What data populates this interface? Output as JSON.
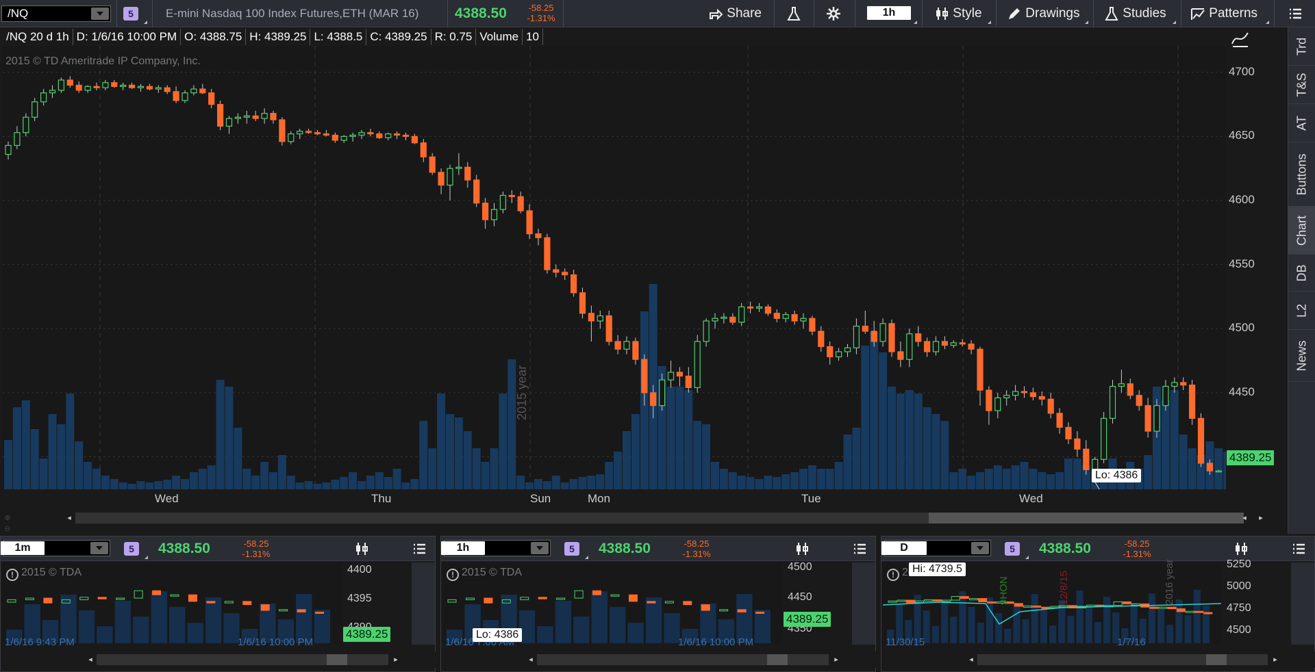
{
  "top": {
    "symbol": "/NQ",
    "group": "5",
    "description": "E-mini Nasdaq 100 Index Futures,ETH (MAR 16)",
    "last": "4388.50",
    "change": "-58.25",
    "change_pct": "-1.31%",
    "timeframe": "1h",
    "share_label": "Share",
    "style_label": "Style",
    "drawings_label": "Drawings",
    "studies_label": "Studies",
    "patterns_label": "Patterns"
  },
  "info": {
    "title": "/NQ 20 d 1h",
    "date": "D: 1/6/16 10:00 PM",
    "open": "O: 4388.75",
    "high": "H: 4389.25",
    "low": "L: 4388.5",
    "close": "C: 4389.25",
    "range": "R: 0.75",
    "volume_label": "Volume",
    "volume": "10"
  },
  "copyright": "2015 © TD Ameritrade IP Company, Inc.",
  "year_label": "2015 year",
  "price_axis": [
    "4700",
    "4650",
    "4600",
    "4550",
    "4500",
    "4450",
    "4400"
  ],
  "time_axis": [
    "Wed",
    "Thu",
    "Sun",
    "Mon",
    "Tue",
    "Wed"
  ],
  "current_price": "4389.25",
  "lo_callout": "Lo: 4386",
  "sidebar": [
    "Trd",
    "T&S",
    "AT",
    "Buttons",
    "Chart",
    "DB",
    "L2",
    "News"
  ],
  "panes": [
    {
      "symbol": "/NQ",
      "group": "5",
      "last": "4388.50",
      "change": "-58.25",
      "change_pct": "-1.31%",
      "timeframe": "1m",
      "copyright": "2015 © TDA",
      "axis": [
        "4400",
        "4395",
        "4390"
      ],
      "price": "4389.25",
      "date_left": "1/6/16 9:43 PM",
      "date_right": "1/6/16 10:00 PM"
    },
    {
      "symbol": "/NQ",
      "group": "5",
      "last": "4388.50",
      "change": "-58.25",
      "change_pct": "-1.31%",
      "timeframe": "1h",
      "copyright": "2015 © TDA",
      "axis": [
        "4500",
        "4450",
        "4350"
      ],
      "price": "4389.25",
      "callout": "Lo: 4386",
      "date_left": "1/6/16 7:00 AM",
      "date_right": "1/6/16 10:00 PM"
    },
    {
      "symbol": "/NQ",
      "group": "5",
      "last": "4388.50",
      "change": "-58.25",
      "change_pct": "-1.31%",
      "timeframe": "D",
      "copyright": "2015 © TDA",
      "axis": [
        "5250",
        "5000",
        "4750",
        "4500"
      ],
      "callout": "Hi: 4739.5",
      "date_left": "11/30/15",
      "date_right": "1/7/16",
      "vlabel1": "9HON",
      "vlabel2": "12/8/15",
      "vlabel3": "2016 year"
    }
  ],
  "colors": {
    "up": "#4cd36f",
    "down": "#ff6a2c",
    "volume": "#173a5e",
    "accent": "#4cd36f"
  },
  "chart_data": {
    "type": "candlestick",
    "interval": "1h",
    "ylim": [
      4380,
      4710
    ],
    "ohlc": [
      [
        4636,
        4646,
        4632,
        4643
      ],
      [
        4643,
        4658,
        4640,
        4653
      ],
      [
        4653,
        4668,
        4650,
        4665
      ],
      [
        4665,
        4680,
        4662,
        4677
      ],
      [
        4677,
        4687,
        4674,
        4684
      ],
      [
        4684,
        4690,
        4680,
        4686
      ],
      [
        4686,
        4696,
        4684,
        4694
      ],
      [
        4694,
        4697,
        4688,
        4690
      ],
      [
        4690,
        4693,
        4684,
        4686
      ],
      [
        4686,
        4690,
        4684,
        4689
      ],
      [
        4689,
        4692,
        4686,
        4688
      ],
      [
        4688,
        4694,
        4686,
        4692
      ],
      [
        4692,
        4694,
        4688,
        4689
      ],
      [
        4689,
        4692,
        4686,
        4690
      ],
      [
        4690,
        4692,
        4687,
        4688
      ],
      [
        4688,
        4691,
        4685,
        4689
      ],
      [
        4689,
        4691,
        4686,
        4687
      ],
      [
        4687,
        4690,
        4684,
        4688
      ],
      [
        4688,
        4690,
        4683,
        4685
      ],
      [
        4685,
        4689,
        4676,
        4678
      ],
      [
        4678,
        4686,
        4676,
        4684
      ],
      [
        4684,
        4690,
        4682,
        4687
      ],
      [
        4687,
        4691,
        4683,
        4684
      ],
      [
        4684,
        4687,
        4672,
        4675
      ],
      [
        4675,
        4678,
        4655,
        4658
      ],
      [
        4658,
        4666,
        4652,
        4664
      ],
      [
        4664,
        4668,
        4660,
        4665
      ],
      [
        4665,
        4670,
        4660,
        4666
      ],
      [
        4666,
        4670,
        4662,
        4664
      ],
      [
        4664,
        4672,
        4660,
        4668
      ],
      [
        4668,
        4670,
        4660,
        4663
      ],
      [
        4663,
        4665,
        4643,
        4646
      ],
      [
        4646,
        4654,
        4644,
        4652
      ],
      [
        4652,
        4656,
        4648,
        4654
      ],
      [
        4654,
        4656,
        4652,
        4653
      ],
      [
        4653,
        4655,
        4651,
        4652
      ],
      [
        4652,
        4655,
        4650,
        4651
      ],
      [
        4651,
        4653,
        4645,
        4647
      ],
      [
        4647,
        4651,
        4645,
        4650
      ],
      [
        4650,
        4653,
        4646,
        4651
      ],
      [
        4651,
        4655,
        4648,
        4653
      ],
      [
        4653,
        4656,
        4650,
        4652
      ],
      [
        4652,
        4654,
        4648,
        4649
      ],
      [
        4649,
        4653,
        4647,
        4652
      ],
      [
        4652,
        4654,
        4648,
        4651
      ],
      [
        4651,
        4653,
        4647,
        4650
      ],
      [
        4650,
        4652,
        4644,
        4645
      ],
      [
        4645,
        4648,
        4630,
        4634
      ],
      [
        4634,
        4637,
        4620,
        4622
      ],
      [
        4622,
        4625,
        4605,
        4612
      ],
      [
        4612,
        4628,
        4600,
        4625
      ],
      [
        4625,
        4637,
        4620,
        4626
      ],
      [
        4626,
        4630,
        4610,
        4616
      ],
      [
        4616,
        4620,
        4595,
        4598
      ],
      [
        4598,
        4602,
        4578,
        4585
      ],
      [
        4585,
        4598,
        4580,
        4593
      ],
      [
        4593,
        4607,
        4590,
        4604
      ],
      [
        4604,
        4608,
        4598,
        4603
      ],
      [
        4603,
        4607,
        4590,
        4592
      ],
      [
        4592,
        4597,
        4570,
        4574
      ],
      [
        4574,
        4578,
        4565,
        4571
      ],
      [
        4571,
        4574,
        4543,
        4546
      ],
      [
        4546,
        4550,
        4540,
        4544
      ],
      [
        4544,
        4547,
        4538,
        4542
      ],
      [
        4542,
        4546,
        4525,
        4528
      ],
      [
        4528,
        4532,
        4508,
        4512
      ],
      [
        4512,
        4518,
        4490,
        4506
      ],
      [
        4506,
        4514,
        4500,
        4510
      ],
      [
        4510,
        4514,
        4487,
        4490
      ],
      [
        4490,
        4495,
        4480,
        4484
      ],
      [
        4484,
        4494,
        4480,
        4490
      ],
      [
        4490,
        4493,
        4472,
        4476
      ],
      [
        4476,
        4480,
        4440,
        4450
      ],
      [
        4450,
        4456,
        4430,
        4440
      ],
      [
        4440,
        4465,
        4436,
        4460
      ],
      [
        4460,
        4475,
        4454,
        4466
      ],
      [
        4466,
        4470,
        4455,
        4463
      ],
      [
        4463,
        4470,
        4450,
        4454
      ],
      [
        4454,
        4495,
        4450,
        4490
      ],
      [
        4490,
        4508,
        4486,
        4506
      ],
      [
        4506,
        4512,
        4500,
        4508
      ],
      [
        4508,
        4512,
        4504,
        4509
      ],
      [
        4509,
        4512,
        4503,
        4505
      ],
      [
        4505,
        4520,
        4502,
        4517
      ],
      [
        4517,
        4521,
        4512,
        4516
      ],
      [
        4516,
        4520,
        4513,
        4517
      ],
      [
        4517,
        4519,
        4510,
        4512
      ],
      [
        4512,
        4515,
        4505,
        4508
      ],
      [
        4508,
        4513,
        4505,
        4511
      ],
      [
        4511,
        4514,
        4503,
        4506
      ],
      [
        4506,
        4512,
        4500,
        4508
      ],
      [
        4508,
        4510,
        4495,
        4498
      ],
      [
        4498,
        4502,
        4482,
        4486
      ],
      [
        4486,
        4490,
        4472,
        4478
      ],
      [
        4478,
        4485,
        4475,
        4482
      ],
      [
        4482,
        4488,
        4478,
        4485
      ],
      [
        4485,
        4508,
        4480,
        4502
      ],
      [
        4502,
        4514,
        4496,
        4498
      ],
      [
        4498,
        4506,
        4486,
        4490
      ],
      [
        4490,
        4508,
        4486,
        4504
      ],
      [
        4504,
        4507,
        4478,
        4482
      ],
      [
        4482,
        4490,
        4470,
        4476
      ],
      [
        4476,
        4500,
        4470,
        4496
      ],
      [
        4496,
        4502,
        4486,
        4490
      ],
      [
        4490,
        4493,
        4478,
        4482
      ],
      [
        4482,
        4494,
        4479,
        4490
      ],
      [
        4490,
        4494,
        4484,
        4487
      ],
      [
        4487,
        4491,
        4485,
        4489
      ],
      [
        4489,
        4492,
        4486,
        4488
      ],
      [
        4488,
        4491,
        4480,
        4484
      ],
      [
        4484,
        4486,
        4440,
        4452
      ],
      [
        4452,
        4455,
        4425,
        4436
      ],
      [
        4436,
        4450,
        4430,
        4446
      ],
      [
        4446,
        4452,
        4440,
        4448
      ],
      [
        4448,
        4456,
        4444,
        4451
      ],
      [
        4451,
        4455,
        4446,
        4450
      ],
      [
        4450,
        4454,
        4444,
        4447
      ],
      [
        4447,
        4451,
        4440,
        4445
      ],
      [
        4445,
        4450,
        4430,
        4434
      ],
      [
        4434,
        4438,
        4418,
        4423
      ],
      [
        4423,
        4427,
        4410,
        4414
      ],
      [
        4414,
        4420,
        4400,
        4406
      ],
      [
        4406,
        4413,
        4386,
        4390
      ],
      [
        4390,
        4400,
        4386,
        4398
      ],
      [
        4398,
        4435,
        4395,
        4430
      ],
      [
        4430,
        4460,
        4426,
        4455
      ],
      [
        4455,
        4468,
        4450,
        4457
      ],
      [
        4457,
        4461,
        4445,
        4448
      ],
      [
        4448,
        4452,
        4436,
        4440
      ],
      [
        4440,
        4446,
        4415,
        4420
      ],
      [
        4420,
        4445,
        4415,
        4440
      ],
      [
        4440,
        4460,
        4436,
        4455
      ],
      [
        4455,
        4462,
        4450,
        4458
      ],
      [
        4458,
        4462,
        4452,
        4456
      ],
      [
        4456,
        4460,
        4425,
        4430
      ],
      [
        4430,
        4434,
        4392,
        4395
      ],
      [
        4395,
        4398,
        4386,
        4389
      ],
      [
        4389,
        4390,
        4388,
        4389
      ]
    ],
    "volume": [
      72,
      120,
      130,
      88,
      45,
      110,
      95,
      140,
      70,
      40,
      30,
      20,
      15,
      10,
      8,
      12,
      10,
      12,
      14,
      20,
      15,
      25,
      30,
      35,
      160,
      150,
      90,
      30,
      20,
      40,
      25,
      50,
      20,
      10,
      12,
      8,
      10,
      14,
      18,
      25,
      12,
      20,
      25,
      18,
      30,
      10,
      15,
      100,
      60,
      140,
      110,
      105,
      85,
      60,
      40,
      60,
      140,
      190,
      20,
      10,
      15,
      12,
      20,
      10,
      15,
      18,
      20,
      22,
      40,
      55,
      85,
      110,
      260,
      300,
      180,
      150,
      150,
      145,
      100,
      95,
      40,
      30,
      25,
      20,
      18,
      15,
      20,
      18,
      22,
      25,
      30,
      35,
      30,
      30,
      40,
      80,
      90,
      210,
      230,
      200,
      150,
      140,
      145,
      140,
      120,
      110,
      100,
      25,
      30,
      20,
      25,
      30,
      35,
      30,
      35,
      40,
      30,
      25,
      22,
      25,
      45,
      45,
      35,
      25,
      20,
      45,
      20,
      40,
      30,
      50,
      150,
      130,
      145,
      80,
      60,
      50,
      70,
      60,
      55,
      20
    ]
  }
}
